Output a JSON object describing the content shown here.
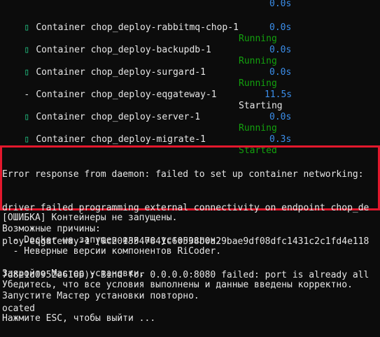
{
  "terminal": {
    "top_time": "0.0s",
    "containers": [
      {
        "mark": "▯",
        "name": "Container chop_deploy-rabbitmq-chop-1",
        "status": "Running",
        "time": "0.0s",
        "state": "ok"
      },
      {
        "mark": "▯",
        "name": "Container chop_deploy-backupdb-1",
        "status": "Running",
        "time": "0.0s",
        "state": "ok"
      },
      {
        "mark": "▯",
        "name": "Container chop_deploy-surgard-1",
        "status": "Running",
        "time": "0.0s",
        "state": "ok"
      },
      {
        "mark": "-",
        "name": "Container chop_deploy-eqgateway-1",
        "status": "Starting",
        "time": "11.5s",
        "state": "pending"
      },
      {
        "mark": "▯",
        "name": "Container chop_deploy-server-1",
        "status": "Running",
        "time": "0.0s",
        "state": "ok"
      },
      {
        "mark": "▯",
        "name": "Container chop_deploy-migrate-1",
        "status": "Started",
        "time": "0.3s",
        "state": "ok"
      }
    ],
    "error_lines": [
      "Error response from daemon: failed to set up container networking:",
      "driver failed programming external connectivity on endpoint chop_de",
      "ploy-eqgateway-1 (9c2013547841c60538b0a29bae9df08dfc1431c2c1fd4e118",
      "7d8e1d0952e6166): Bind for 0.0.0.0:8080 failed: port is already all",
      "ocated"
    ],
    "messages": {
      "error_title": "[ОШИБКА] Контейнеры не запущены.",
      "reasons_title": "Возможные причины:",
      "reason_1": "  - Docker не запущен или не установлен.",
      "reason_2": "  - Неверные версии компонентов RiCoder.",
      "advice_1": "Закройте Мастер установки.",
      "advice_2": "Убедитесь, что все условия выполнены и данные введены корректно.",
      "advice_3": "Запустите Мастер установки повторно.",
      "exit_prompt": "Нажмите ESC, чтобы выйти ..."
    },
    "colors": {
      "background": "#0c0c0c",
      "text": "#e6e6e6",
      "running": "#13a10e",
      "time": "#3b8eea",
      "error_border": "#e3182d"
    }
  }
}
